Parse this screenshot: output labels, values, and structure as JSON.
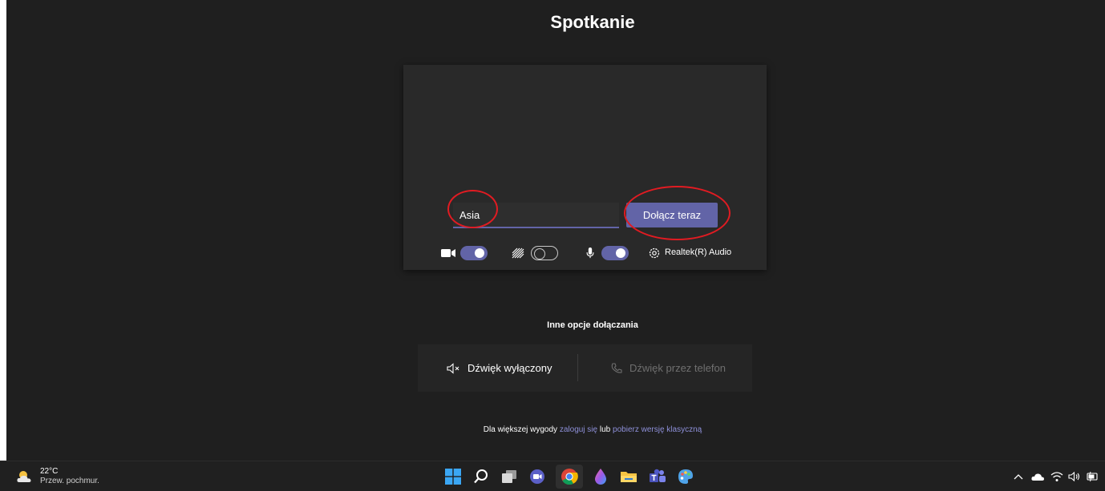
{
  "title": "Spotkanie",
  "join": {
    "name_value": "Asia",
    "button_label": "Dołącz teraz"
  },
  "controls": {
    "camera_on": true,
    "background_effects_on": false,
    "microphone_on": true,
    "audio_device": "Realtek(R) Audio"
  },
  "other_options": {
    "label": "Inne opcje dołączania",
    "audio_off": "Dźwięk wyłączony",
    "phone_audio": "Dźwięk przez telefon"
  },
  "footer": {
    "prefix": "Dla większej wygody",
    "login_link": "zaloguj się",
    "middle": "lub",
    "download_link": "pobierz wersję klasyczną"
  },
  "taskbar": {
    "weather_temp": "22°C",
    "weather_desc": "Przew. pochmur.",
    "icons": [
      "windows-start-icon",
      "search-icon",
      "task-view-icon",
      "chat-icon",
      "chrome-icon",
      "drop-app-icon",
      "file-explorer-icon",
      "teams-icon",
      "paint-icon"
    ],
    "tray": [
      "chevron-up-icon",
      "onedrive-icon",
      "wifi-icon",
      "volume-icon",
      "battery-icon"
    ]
  },
  "colors": {
    "accent": "#6264a7",
    "background": "#1f1f1f",
    "annotation": "#e11b22"
  }
}
